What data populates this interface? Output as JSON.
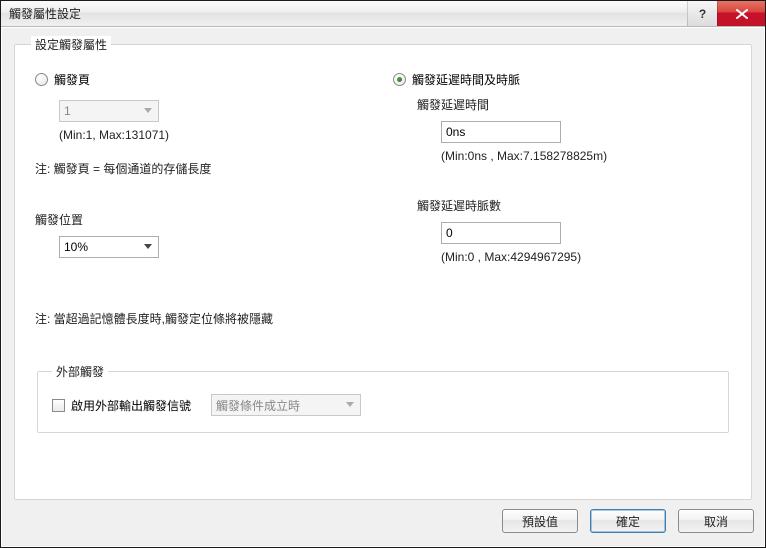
{
  "window": {
    "title": "觸發屬性設定"
  },
  "main_legend": "設定觸發屬性",
  "left": {
    "radio_page_label": "觸發頁",
    "page_value": "1",
    "page_hint": "(Min:1, Max:131071)",
    "page_note": "注: 觸發頁 = 每個通道的存儲長度",
    "position_label": "觸發位置",
    "position_value": "10%"
  },
  "right": {
    "radio_delay_label": "觸發延遲時間及時脈",
    "delay_time_label": "觸發延遲時間",
    "delay_time_value": "0ns",
    "delay_time_hint": "(Min:0ns , Max:7.158278825m)",
    "delay_clock_label": "觸發延遲時脈數",
    "delay_clock_value": "0",
    "delay_clock_hint": "(Min:0 , Max:4294967295)"
  },
  "memory_note": "注: 當超過記憶體長度時,觸發定位條將被隱藏",
  "external": {
    "legend": "外部觸發",
    "checkbox_label": "啟用外部輸出觸發信號",
    "condition_value": "觸發條件成立時"
  },
  "footer": {
    "default": "預設值",
    "ok": "確定",
    "cancel": "取消"
  }
}
